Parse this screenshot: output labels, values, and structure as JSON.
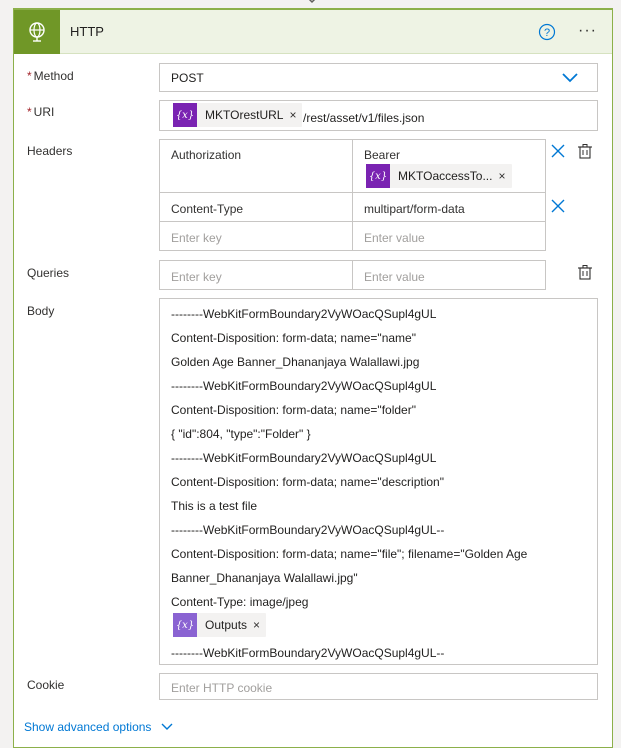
{
  "header": {
    "title": "HTTP",
    "help_icon": "question-circle-icon",
    "more_label": "···"
  },
  "method": {
    "label": "Method",
    "required": "*",
    "value": "POST"
  },
  "uri": {
    "label": "URI",
    "required": "*",
    "token_label": "MKTOrestURL",
    "token_close": "×",
    "suffix": "/rest/asset/v1/files.json"
  },
  "headers": {
    "label": "Headers",
    "rows": [
      {
        "key": "Authorization",
        "value": "Bearer",
        "token_label": "MKTOaccessTo...",
        "token_close": "×"
      },
      {
        "key": "Content-Type",
        "value": "multipart/form-data"
      }
    ],
    "key_placeholder": "Enter key",
    "value_placeholder": "Enter value"
  },
  "queries": {
    "label": "Queries",
    "key_placeholder": "Enter key",
    "value_placeholder": "Enter value"
  },
  "body": {
    "label": "Body",
    "lines": [
      "--------WebKitFormBoundary2VyWOacQSupl4gUL",
      "Content-Disposition: form-data; name=\"name\"",
      "Golden Age Banner_Dhananjaya Walallawi.jpg",
      "--------WebKitFormBoundary2VyWOacQSupl4gUL",
      "Content-Disposition: form-data; name=\"folder\"",
      "{ \"id\":804, \"type\":\"Folder\" }",
      "--------WebKitFormBoundary2VyWOacQSupl4gUL",
      "Content-Disposition: form-data; name=\"description\"",
      "This is a test file",
      "--------WebKitFormBoundary2VyWOacQSupl4gUL--",
      "Content-Disposition: form-data; name=\"file\"; filename=\"Golden Age",
      "Banner_Dhananjaya Walallawi.jpg\"",
      "Content-Type: image/jpeg"
    ],
    "token_label": "Outputs",
    "token_close": "×",
    "last_line": "--------WebKitFormBoundary2VyWOacQSupl4gUL--"
  },
  "cookie": {
    "label": "Cookie",
    "placeholder": "Enter HTTP cookie"
  },
  "advanced": {
    "label": "Show advanced options"
  },
  "colors": {
    "accent": "#709727",
    "token": "#7a23b2",
    "link": "#0078d4",
    "border": "#8cb04a"
  }
}
